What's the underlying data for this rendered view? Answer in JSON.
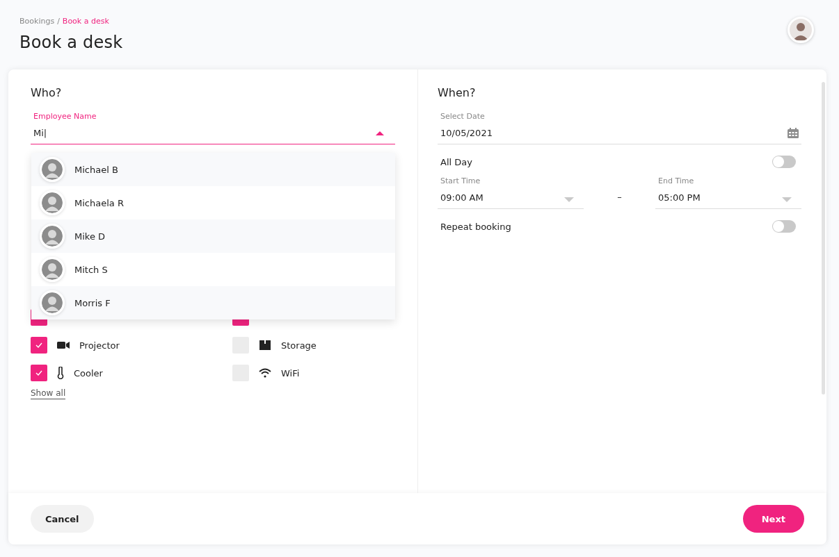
{
  "breadcrumb": {
    "parent": "Bookings",
    "separator": "/",
    "current": "Book a desk"
  },
  "title": "Book a desk",
  "who": {
    "heading": "Who?",
    "employee_field": {
      "label": "Employee Name",
      "value": "Mi|",
      "expanded": true
    },
    "suggestions": [
      {
        "name": "Michael B",
        "selected": false
      },
      {
        "name": "Michaela R",
        "selected": false
      },
      {
        "name": "Mike D",
        "selected": false
      },
      {
        "name": "Mitch S",
        "selected": false
      },
      {
        "name": "Morris F",
        "selected": false
      }
    ],
    "amenities": [
      {
        "checked": true
      },
      {
        "checked": true
      },
      {
        "kind": "camera",
        "label": "Projector",
        "checked": true
      },
      {
        "kind": "box",
        "label": "Storage",
        "checked": false
      },
      {
        "kind": "thermometer",
        "label": "Cooler",
        "checked": true
      },
      {
        "kind": "wifi",
        "label": "WiFi",
        "checked": false
      }
    ],
    "show_all": "Show all"
  },
  "when": {
    "heading": "When?",
    "date_field": {
      "label": "Select Date",
      "value": "10/05/2021"
    },
    "all_day": {
      "label": "All Day",
      "on": false
    },
    "start_time": {
      "label": "Start Time",
      "value": "09:00 AM"
    },
    "separator": "–",
    "end_time": {
      "label": "End Time",
      "value": "05:00 PM"
    },
    "repeat": {
      "label": "Repeat booking",
      "on": false
    }
  },
  "buttons": {
    "cancel": "Cancel",
    "next": "Next"
  }
}
